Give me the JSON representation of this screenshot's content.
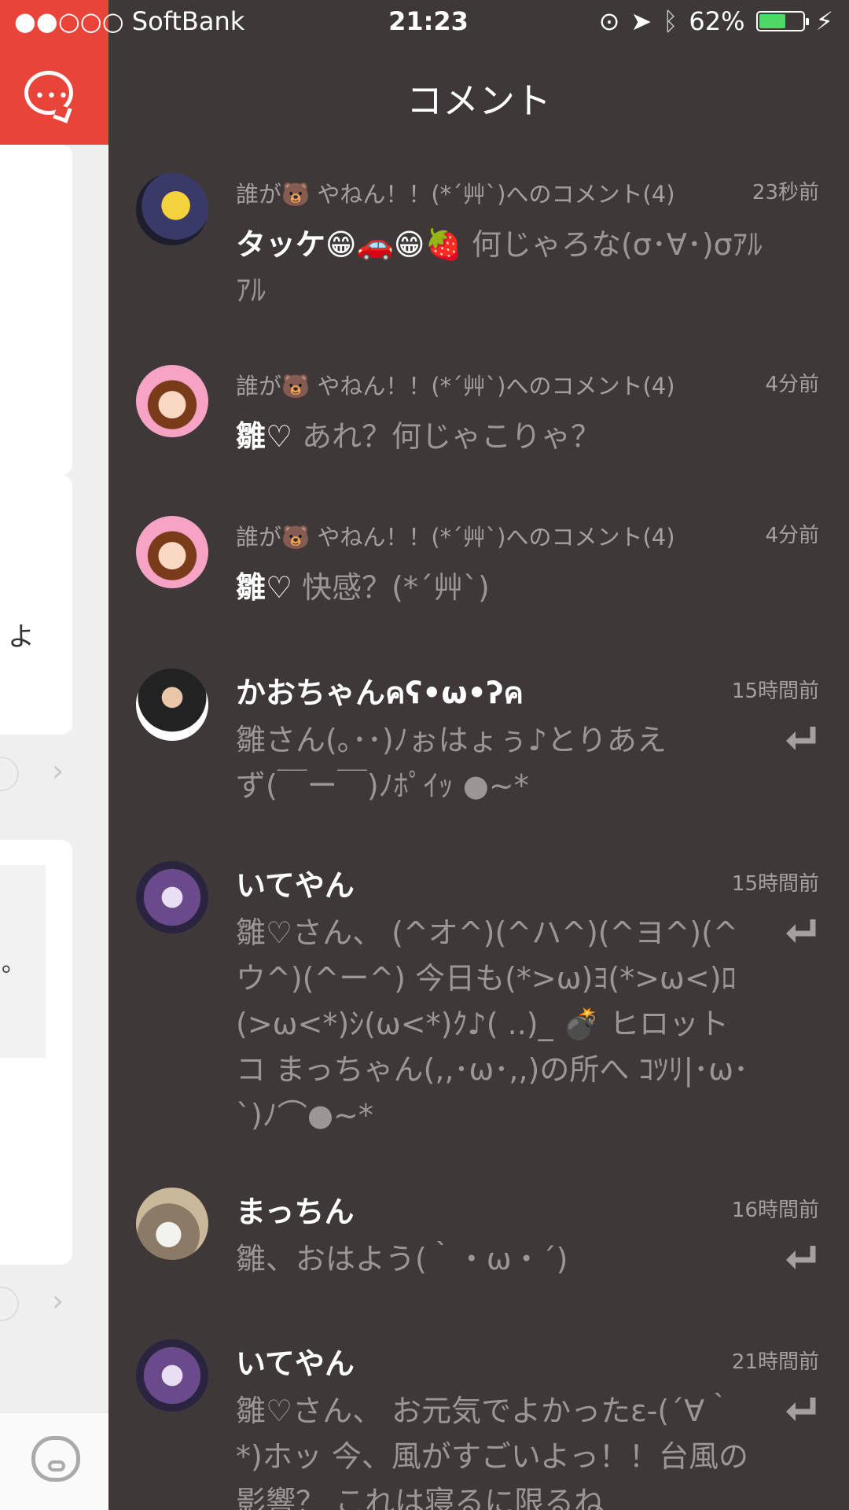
{
  "status_bar": {
    "carrier": "●●○○○ SoftBank",
    "time": "21:23",
    "battery": "62%",
    "battery_level": 0.62
  },
  "left_page": {
    "snippet_1": "よ",
    "snippet_2": "。"
  },
  "header": {
    "title": "コメント"
  },
  "comments": [
    {
      "subtitle": "誰が🐻 やねん！！(*´艸`)へのコメント(4)",
      "time": "23秒前",
      "author": "タッケ😁🚗😁🍓",
      "text": " 何じゃろな(σ･∀･)σｱﾙｱﾙ"
    },
    {
      "subtitle": "誰が🐻 やねん！！(*´艸`)へのコメント(4)",
      "time": "4分前",
      "author": "雛♡",
      "text": " あれ？何じゃこりゃ？"
    },
    {
      "subtitle": "誰が🐻 やねん！！(*´艸`)へのコメント(4)",
      "time": "4分前",
      "author": "雛♡",
      "text": " 快感？(*´艸`)"
    },
    {
      "name": "かおちゃんคʕ•ω•ʔค",
      "time": "15時間前",
      "text": "雛さん(｡･･)ﾉぉはょぅ♪とりあえず(￣ー￣)ﾉﾎﾟｲｯ ●~*"
    },
    {
      "name": "いてやん",
      "time": "15時間前",
      "text": "雛♡さん、 (^オ^)(^ハ^)(^ヨ^)(^ウ^)(^ー^) 今日も(*>ω)ﾖ(*>ω<)ﾛ(>ω<*)ｼ(ω<*)ｸ♪( ..)_ 💣 ヒロットコ まっちゃん(,,･ω･,,)の所へ ｺﾂﾘ|･ω･`)ﾉ⌒●~*"
    },
    {
      "name": "まっちん",
      "time": "16時間前",
      "text": "雛、おはよう(｀・ω・´)"
    },
    {
      "name": "いてやん",
      "time": "21時間前",
      "text": "雛♡さん、 お元気でよかったε-(´∀｀*)ホッ 今、風がすごいよっ！！台風の影響？ これは寝るに限るね"
    }
  ],
  "colors": {
    "panel_bg": "#3e3838",
    "accent_red": "#e8443a",
    "muted_text": "#9c9696",
    "battery_green": "#4cd964"
  }
}
